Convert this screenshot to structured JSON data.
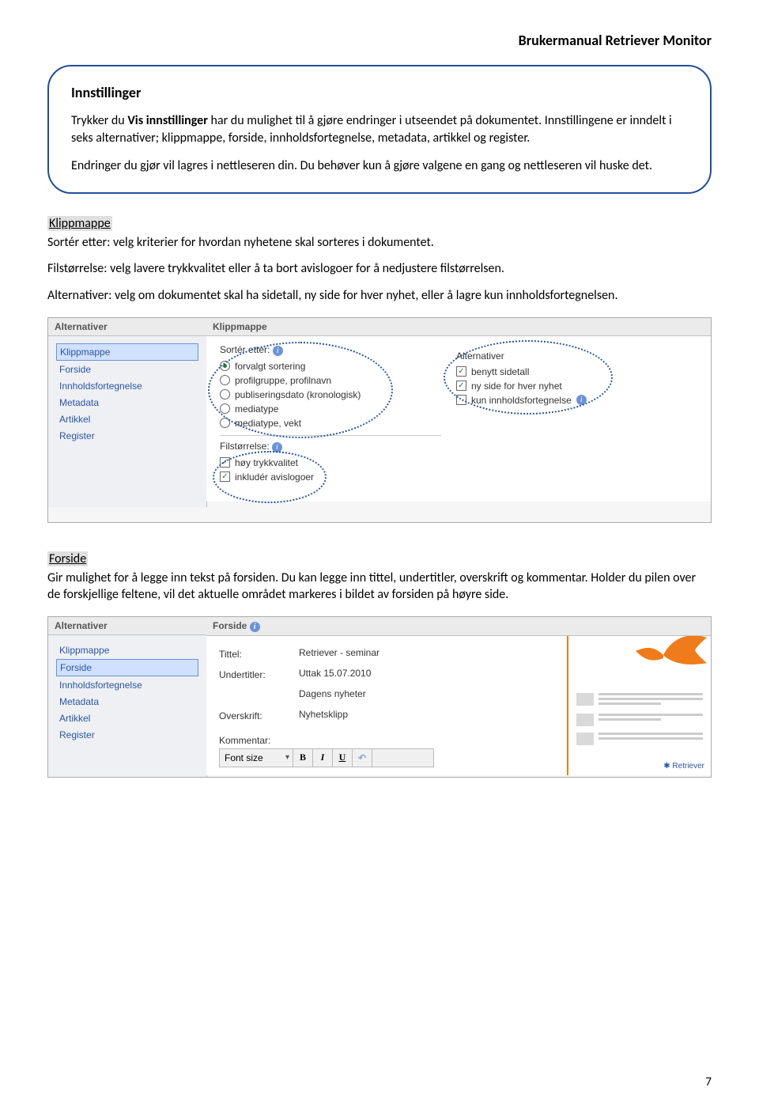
{
  "header": {
    "title": "Brukermanual Retriever Monitor"
  },
  "callout": {
    "heading": "Innstillinger",
    "p1a": "Trykker du ",
    "p1b": "Vis innstillinger",
    "p1c": " har du mulighet til å gjøre endringer i utseendet på dokumentet. Innstillingene er inndelt i seks alternativer; klippmappe, forside, innholdsfortegnelse, metadata, artikkel og register.",
    "p2": "Endringer du gjør vil lagres i nettleseren din. Du behøver kun å gjøre valgene en gang og nettleseren vil huske det."
  },
  "klipp": {
    "label": "Klippmappe",
    "line1": "Sortér etter: velg kriterier for hvordan nyhetene skal sorteres i dokumentet.",
    "line2": "Filstørrelse: velg lavere trykkvalitet eller å ta bort avislogoer for å nedjustere filstørrelsen.",
    "line3": "Alternativer: velg om dokumentet skal ha sidetall, ny side for hver nyhet, eller å lagre kun innholdsfortegnelsen."
  },
  "panel1": {
    "col_alt": "Alternativer",
    "col_main": "Klippmappe",
    "side_items": [
      "Klippmappe",
      "Forside",
      "Innholdsfortegnelse",
      "Metadata",
      "Artikkel",
      "Register"
    ],
    "sort_label": "Sortér etter:",
    "sort_opts": [
      "forvalgt sortering",
      "profilgruppe, profilnavn",
      "publiseringsdato (kronologisk)",
      "mediatype",
      "mediatype, vekt"
    ],
    "fil_label": "Filstørrelse:",
    "fil_opts": [
      "høy trykkvalitet",
      "inkludér avislogoer"
    ],
    "alt_label": "Alternativer",
    "alt_opts": [
      "benytt sidetall",
      "ny side for hver nyhet",
      "kun innholdsfortegnelse"
    ]
  },
  "forside": {
    "label": "Forside",
    "text": "Gir mulighet for å legge inn tekst på forsiden.  Du kan legge inn tittel, undertitler, overskrift og kommentar. Holder du pilen over de forskjellige feltene, vil det aktuelle området markeres i bildet av forsiden på høyre side."
  },
  "panel2": {
    "col_alt": "Alternativer",
    "col_main": "Forside",
    "side_items": [
      "Klippmappe",
      "Forside",
      "Innholdsfortegnelse",
      "Metadata",
      "Artikkel",
      "Register"
    ],
    "f_tittel_l": "Tittel:",
    "f_tittel_v": "Retriever - seminar",
    "f_under_l": "Undertitler:",
    "f_under_v1": "Uttak 15.07.2010",
    "f_under_v2": "Dagens nyheter",
    "f_over_l": "Overskrift:",
    "f_over_v": "Nyhetsklipp",
    "f_komm_l": "Kommentar:",
    "fontsize": "Font size",
    "b": "B",
    "i": "I",
    "u": "U",
    "undo": "↶",
    "footer_brand": "Retriever"
  },
  "page_number": "7"
}
